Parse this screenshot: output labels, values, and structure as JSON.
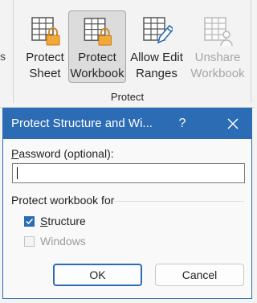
{
  "ribbon": {
    "left_fragment": "s",
    "buttons": [
      {
        "line1": "Protect",
        "line2": "Sheet",
        "icon": "protect-sheet-icon"
      },
      {
        "line1": "Protect",
        "line2": "Workbook",
        "icon": "protect-workbook-icon",
        "selected": true
      },
      {
        "line1": "Allow Edit",
        "line2": "Ranges",
        "icon": "allow-edit-ranges-icon"
      },
      {
        "line1": "Unshare",
        "line2": "Workbook",
        "icon": "unshare-workbook-icon",
        "disabled": true
      }
    ],
    "group_label": "Protect"
  },
  "dialog": {
    "title": "Protect Structure and Wi...",
    "help_glyph": "?",
    "password_label_accesskey": "P",
    "password_label_rest": "assword (optional):",
    "password_value": "",
    "section_label": "Protect workbook for",
    "structure_accesskey": "S",
    "structure_rest": "tructure",
    "structure_checked": true,
    "windows_accesskey": "W",
    "windows_rest": "indows",
    "windows_checked": false,
    "windows_disabled": true,
    "ok_label": "OK",
    "cancel_label": "Cancel"
  },
  "colors": {
    "accent": "#2b6cb5",
    "ribbon_bg": "#f3f3f3",
    "disabled_text": "#a6a6a6"
  }
}
